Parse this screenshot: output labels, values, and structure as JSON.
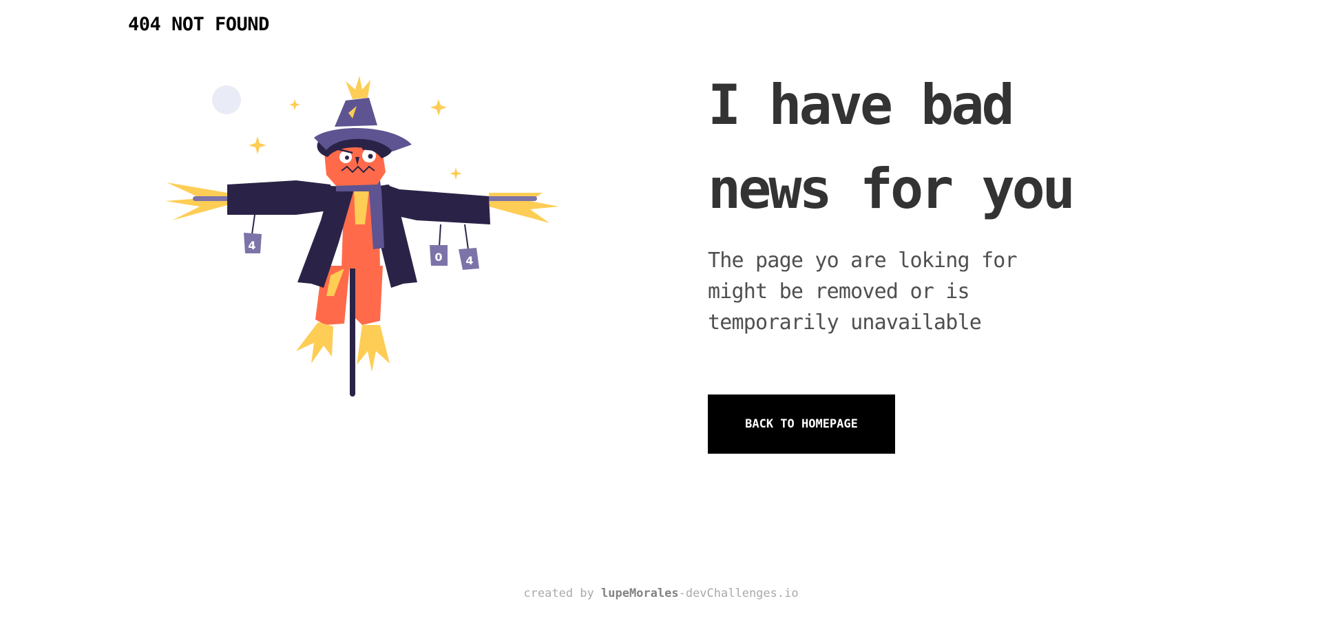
{
  "header": {
    "brand": "404 NOT FOUND"
  },
  "illustration": {
    "icon": "scarecrow-illustration",
    "can_labels": [
      "4",
      "0",
      "4"
    ],
    "colors": {
      "coat": "#2B2347",
      "hat": "#5E5491",
      "face": "#FF6B4A",
      "straw": "#FDCD55",
      "moon": "#E9EBF6",
      "can": "#7C74A8"
    }
  },
  "main": {
    "headline_line1": "I have bad",
    "headline_line2": "news for you",
    "subtext_line1": "The page yo are loking for",
    "subtext_line2": "might be removed or is",
    "subtext_line3": "temporarily unavailable",
    "cta_label": "BACK TO HOMEPAGE"
  },
  "footer": {
    "prefix": "created by ",
    "author": "lupeMorales",
    "suffix": "-devChallenges.io"
  },
  "colors": {
    "button_bg": "#000000",
    "button_text": "#FFFFFF",
    "headline": "#333333",
    "body_text": "#4F4F4F",
    "footer_text": "#A9A9A9"
  }
}
